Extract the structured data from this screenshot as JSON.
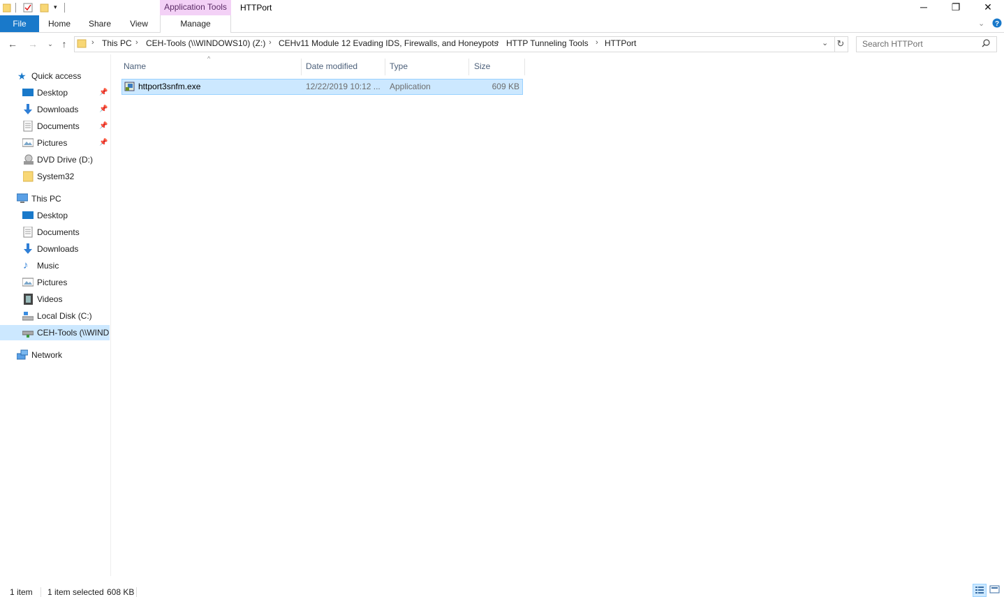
{
  "titlebar": {
    "context_tab": "Application Tools",
    "title": "HTTPort",
    "minimize": "─",
    "restore": "❐",
    "close": "✕"
  },
  "ribbon": {
    "file": "File",
    "tabs": [
      "Home",
      "Share",
      "View"
    ],
    "manage": "Manage",
    "expand_icon": "chevron-down-icon",
    "help_icon": "help-icon"
  },
  "address": {
    "crumbs": [
      "This PC",
      "CEH-Tools (\\\\WINDOWS10) (Z:)",
      "CEHv11 Module 12 Evading IDS, Firewalls, and Honeypots",
      "HTTP Tunneling Tools",
      "HTTPort"
    ],
    "search_placeholder": "Search HTTPort"
  },
  "nav": {
    "quick_access": "Quick access",
    "quick_items": [
      {
        "label": "Desktop",
        "pinned": true
      },
      {
        "label": "Downloads",
        "pinned": true
      },
      {
        "label": "Documents",
        "pinned": true
      },
      {
        "label": "Pictures",
        "pinned": true
      },
      {
        "label": "DVD Drive (D:)",
        "pinned": false
      },
      {
        "label": "System32",
        "pinned": false
      }
    ],
    "this_pc": "This PC",
    "pc_items": [
      "Desktop",
      "Documents",
      "Downloads",
      "Music",
      "Pictures",
      "Videos",
      "Local Disk (C:)",
      "CEH-Tools (\\\\WIND"
    ],
    "network": "Network"
  },
  "columns": {
    "name": "Name",
    "date": "Date modified",
    "type": "Type",
    "size": "Size"
  },
  "files": [
    {
      "name": "httport3snfm.exe",
      "date": "12/22/2019 10:12 ...",
      "type": "Application",
      "size": "609 KB"
    }
  ],
  "status": {
    "count": "1 item",
    "selected": "1 item selected",
    "size": "608 KB"
  },
  "colors": {
    "accent": "#1979ca",
    "selection": "#cce8ff",
    "context_tab": "#f3d1f6"
  }
}
